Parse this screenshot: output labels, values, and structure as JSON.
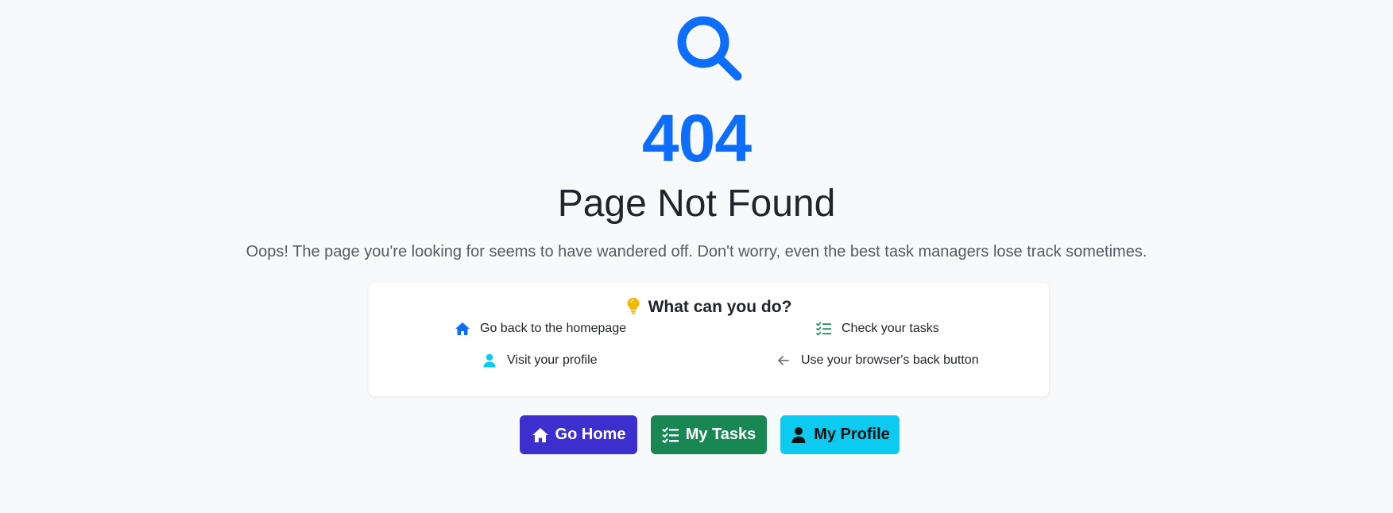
{
  "error": {
    "code": "404",
    "title": "Page Not Found",
    "message": "Oops! The page you're looking for seems to have wandered off. Don't worry, even the best task managers lose track sometimes."
  },
  "tips": {
    "heading": "What can you do?",
    "items": {
      "home": "Go back to the homepage",
      "tasks": "Check your tasks",
      "profile": "Visit your profile",
      "back": "Use your browser's back button"
    }
  },
  "buttons": {
    "home": "Go Home",
    "tasks": "My Tasks",
    "profile": "My Profile"
  },
  "icons": {
    "hero": "search-icon",
    "heading": "lightbulb-icon",
    "home": "home-icon",
    "tasks": "checklist-icon",
    "profile": "user-icon",
    "back": "arrow-left-icon"
  },
  "colors": {
    "primary": "#0d6efd",
    "home_button": "#3d2fce",
    "tasks_button": "#198754",
    "profile_button": "#0dcaf0",
    "bulb": "#f5b800",
    "background": "#f8f9fa"
  }
}
